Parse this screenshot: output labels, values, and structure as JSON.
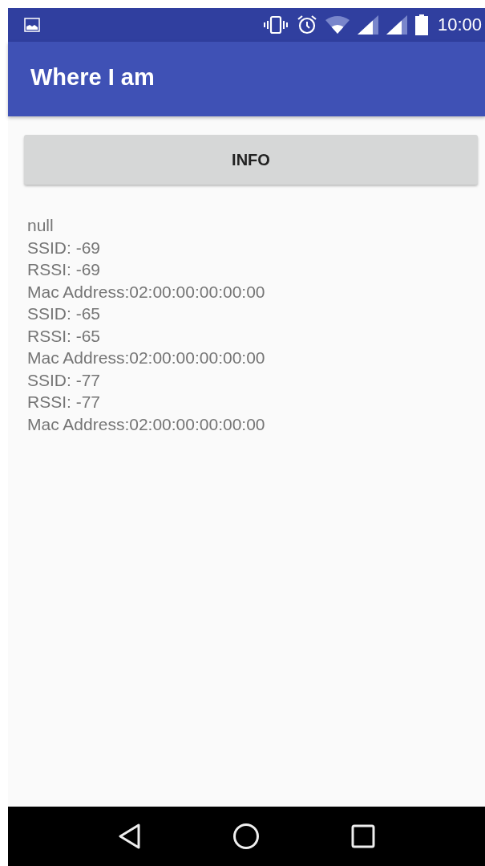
{
  "status_bar": {
    "time": "10:00"
  },
  "app_bar": {
    "title": "Where I am"
  },
  "button": {
    "label": "INFO"
  },
  "output_lines": [
    "null",
    "SSID: -69",
    "RSSI: -69",
    "Mac Address:02:00:00:00:00:00",
    "SSID: -65",
    "RSSI: -65",
    "Mac Address:02:00:00:00:00:00",
    "SSID: -77",
    "RSSI: -77",
    "Mac Address:02:00:00:00:00:00"
  ]
}
